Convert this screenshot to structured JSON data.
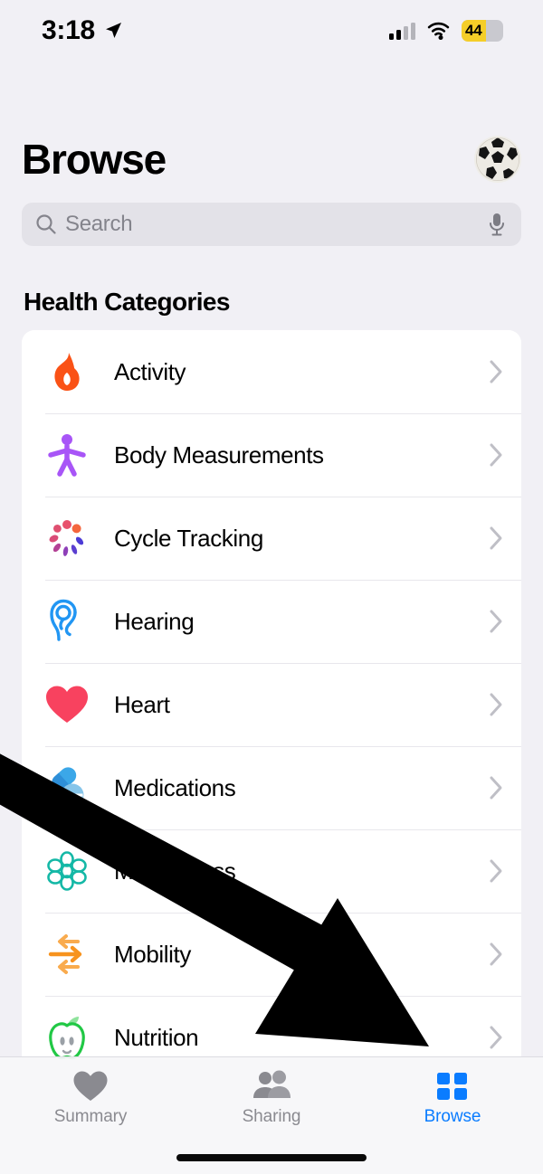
{
  "status_bar": {
    "time": "3:18",
    "location_icon": "location-arrow-icon",
    "cellular_icon": "cellular-signal-icon",
    "cellular_bars_filled": 2,
    "cellular_bars_total": 4,
    "wifi_icon": "wifi-icon",
    "battery_percent": "44",
    "battery_color": "#F5CE28"
  },
  "header": {
    "title": "Browse",
    "avatar_icon": "soccer-ball-avatar"
  },
  "search": {
    "placeholder": "Search",
    "search_icon": "search-icon",
    "mic_icon": "microphone-icon"
  },
  "section": {
    "title": "Health Categories"
  },
  "categories": [
    {
      "label": "Activity",
      "icon": "flame-icon",
      "color": "#FA5216"
    },
    {
      "label": "Body Measurements",
      "icon": "body-figure-icon",
      "color": "#A855F7"
    },
    {
      "label": "Cycle Tracking",
      "icon": "cycle-petals-icon",
      "color": "#E05270"
    },
    {
      "label": "Hearing",
      "icon": "ear-icon",
      "color": "#2196F3"
    },
    {
      "label": "Heart",
      "icon": "heart-icon",
      "color": "#F8425F"
    },
    {
      "label": "Medications",
      "icon": "pills-icon",
      "color": "#32A0E0"
    },
    {
      "label": "Mindfulness",
      "icon": "brain-icon",
      "color": "#14B8A6"
    },
    {
      "label": "Mobility",
      "icon": "arrows-icon",
      "color": "#F79327"
    },
    {
      "label": "Nutrition",
      "icon": "apple-icon",
      "color": "#21C845"
    }
  ],
  "chevron_icon": "chevron-right-icon",
  "tabs": [
    {
      "label": "Summary",
      "icon": "heart-tab-icon",
      "active": false
    },
    {
      "label": "Sharing",
      "icon": "people-tab-icon",
      "active": false
    },
    {
      "label": "Browse",
      "icon": "grid-tab-icon",
      "active": true
    }
  ],
  "accent_color": "#0A7CFF",
  "overlay": {
    "annotation_icon": "black-arrow-annotation"
  }
}
